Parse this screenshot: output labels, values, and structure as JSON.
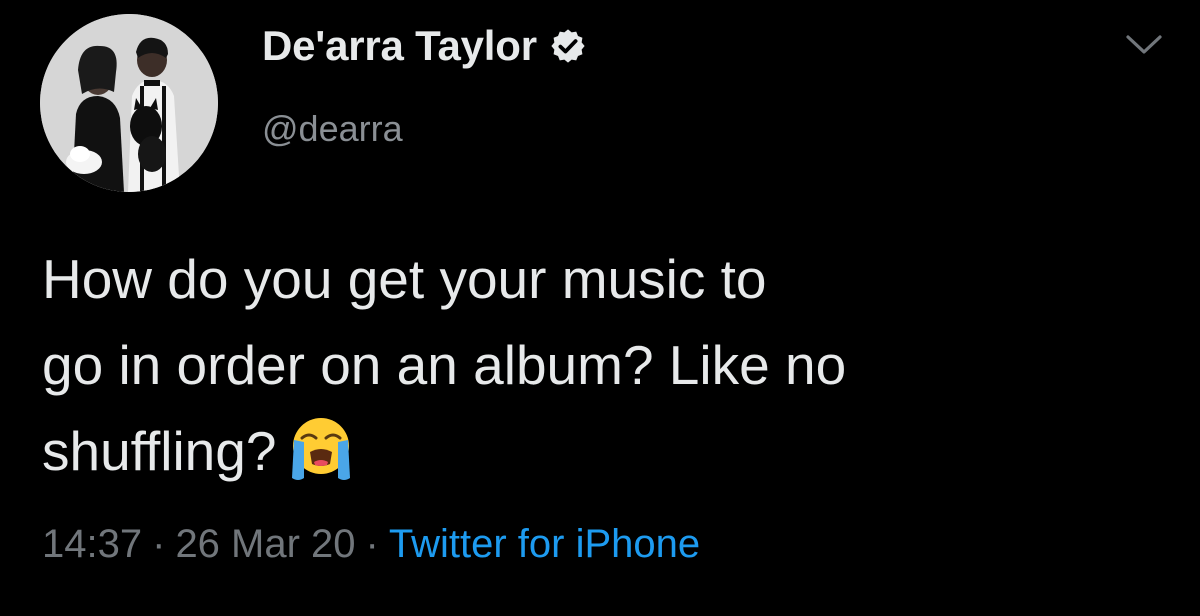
{
  "author": {
    "display_name": "De'arra Taylor",
    "handle": "@dearra",
    "verified": true,
    "verified_icon": "verified-badge-icon"
  },
  "tweet": {
    "lines": [
      "How do you get your music to",
      "go in order on an album? Like no",
      "shuffling?"
    ],
    "emoji": "loudly-crying-face"
  },
  "meta": {
    "time": "14:37",
    "separator": "·",
    "date": "26 Mar 20",
    "client": "Twitter for iPhone"
  },
  "colors": {
    "background": "#000000",
    "text": "#e7e9ea",
    "secondary_text": "#71767b",
    "link": "#1d9bf0"
  },
  "icons": {
    "more_menu": "chevron-down-icon"
  }
}
